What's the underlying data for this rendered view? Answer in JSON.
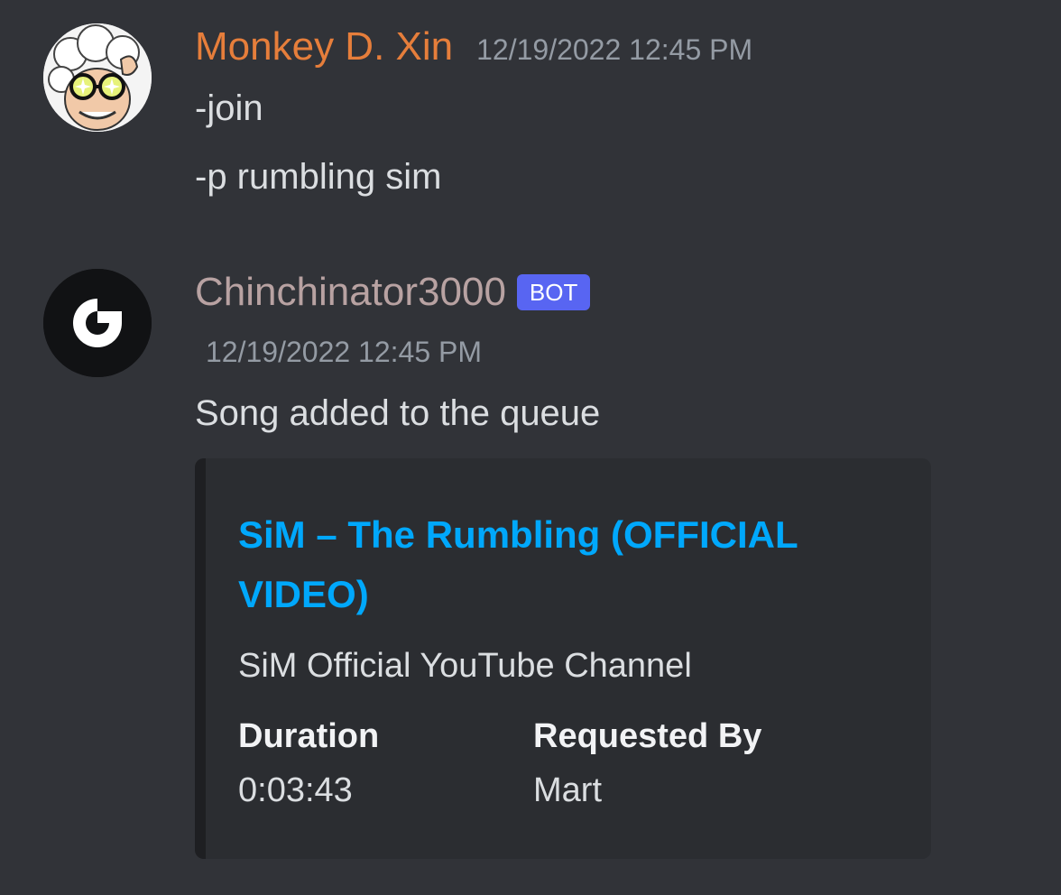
{
  "messages": [
    {
      "author": "Monkey D. Xin",
      "author_color": "#e67e3b",
      "timestamp": "12/19/2022 12:45 PM",
      "avatar": "anime-character-avatar",
      "lines": [
        "-join",
        "-p rumbling sim"
      ]
    },
    {
      "author": "Chinchinator3000",
      "author_color": "#b8a2a2",
      "badge": "BOT",
      "timestamp": "12/19/2022 12:45 PM",
      "avatar": "bot-logo-avatar",
      "text": "Song added to the queue",
      "embed": {
        "title": "SiM – The Rumbling (OFFICIAL VIDEO)",
        "title_color": "#00a8fc",
        "description": "SiM Official YouTube Channel",
        "fields": [
          {
            "name": "Duration",
            "value": "0:03:43"
          },
          {
            "name": "Requested By",
            "value": "Mart"
          }
        ]
      }
    }
  ]
}
